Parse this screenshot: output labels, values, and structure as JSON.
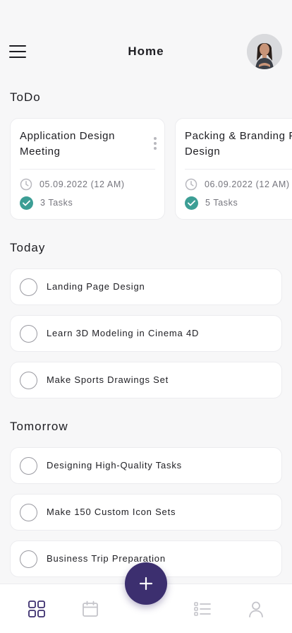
{
  "header": {
    "title": "Home",
    "menu_icon": "hamburger-menu-icon",
    "avatar_icon": "user-avatar"
  },
  "sections": {
    "todo": "ToDo",
    "today": "Today",
    "tomorrow": "Tomorrow"
  },
  "todo_cards": [
    {
      "title": "Application Design Meeting",
      "date": "05.09.2022 (12 AM)",
      "tasks": "3 Tasks"
    },
    {
      "title": "Packing & Branding Full Design",
      "date": "06.09.2022 (12 AM)",
      "tasks": "5 Tasks"
    }
  ],
  "today_tasks": [
    {
      "label": "Landing Page Design"
    },
    {
      "label": "Learn 3D Modeling in Cinema 4D"
    },
    {
      "label": "Make Sports Drawings Set"
    }
  ],
  "tomorrow_tasks": [
    {
      "label": "Designing High-Quality Tasks"
    },
    {
      "label": "Make 150 Custom Icon Sets"
    },
    {
      "label": "Business Trip Preparation"
    }
  ],
  "bottom_nav": {
    "items": [
      "grid-home-icon",
      "calendar-icon",
      "task-list-icon",
      "profile-icon"
    ],
    "fab_icon": "plus-icon"
  },
  "colors": {
    "accent": "#3c2f6f",
    "check": "#3c9e95",
    "background": "#f7f7f8"
  }
}
